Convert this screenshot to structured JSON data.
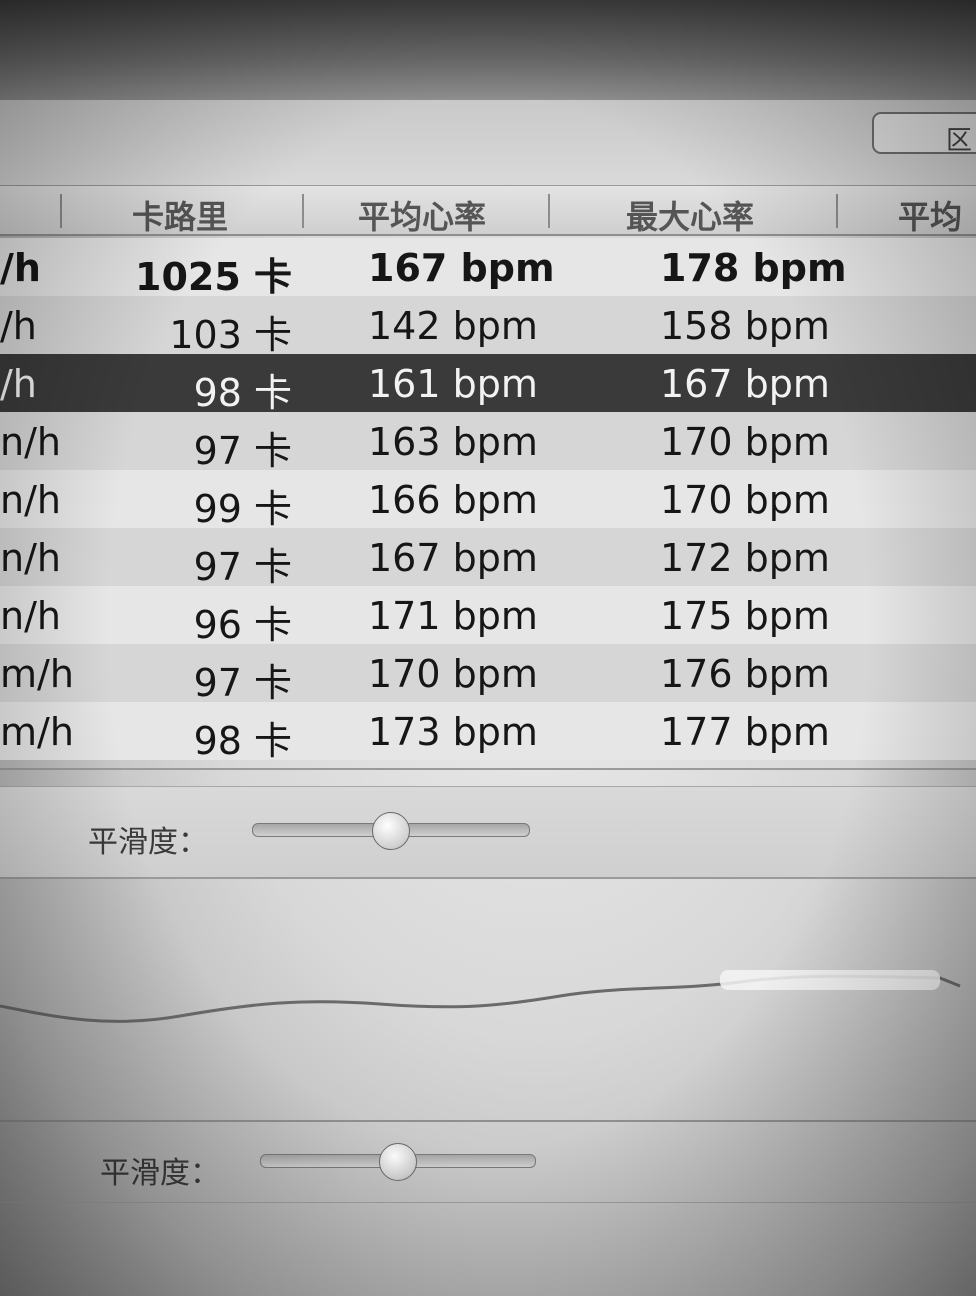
{
  "toolbar": {
    "button_label": "区"
  },
  "table": {
    "columns": [
      "卡路里",
      "平均心率",
      "最大心率",
      "平均"
    ],
    "rows": [
      {
        "speed": "/h",
        "calories": "1025 卡",
        "avg_hr": "167 bpm",
        "max_hr": "178 bpm",
        "bold": true,
        "selected": false
      },
      {
        "speed": "/h",
        "calories": "103 卡",
        "avg_hr": "142 bpm",
        "max_hr": "158 bpm",
        "bold": false,
        "selected": false
      },
      {
        "speed": "/h",
        "calories": "98 卡",
        "avg_hr": "161 bpm",
        "max_hr": "167 bpm",
        "bold": false,
        "selected": true
      },
      {
        "speed": "n/h",
        "calories": "97 卡",
        "avg_hr": "163 bpm",
        "max_hr": "170 bpm",
        "bold": false,
        "selected": false
      },
      {
        "speed": "n/h",
        "calories": "99 卡",
        "avg_hr": "166 bpm",
        "max_hr": "170 bpm",
        "bold": false,
        "selected": false
      },
      {
        "speed": "n/h",
        "calories": "97 卡",
        "avg_hr": "167 bpm",
        "max_hr": "172 bpm",
        "bold": false,
        "selected": false
      },
      {
        "speed": "n/h",
        "calories": "96 卡",
        "avg_hr": "171 bpm",
        "max_hr": "175 bpm",
        "bold": false,
        "selected": false
      },
      {
        "speed": "m/h",
        "calories": "97 卡",
        "avg_hr": "170 bpm",
        "max_hr": "176 bpm",
        "bold": false,
        "selected": false
      },
      {
        "speed": "m/h",
        "calories": "98 卡",
        "avg_hr": "173 bpm",
        "max_hr": "177 bpm",
        "bold": false,
        "selected": false
      }
    ]
  },
  "smoothing_1": {
    "label": "平滑度：",
    "value": 0.5
  },
  "smoothing_2": {
    "label": "平滑度：",
    "value": 0.5
  }
}
